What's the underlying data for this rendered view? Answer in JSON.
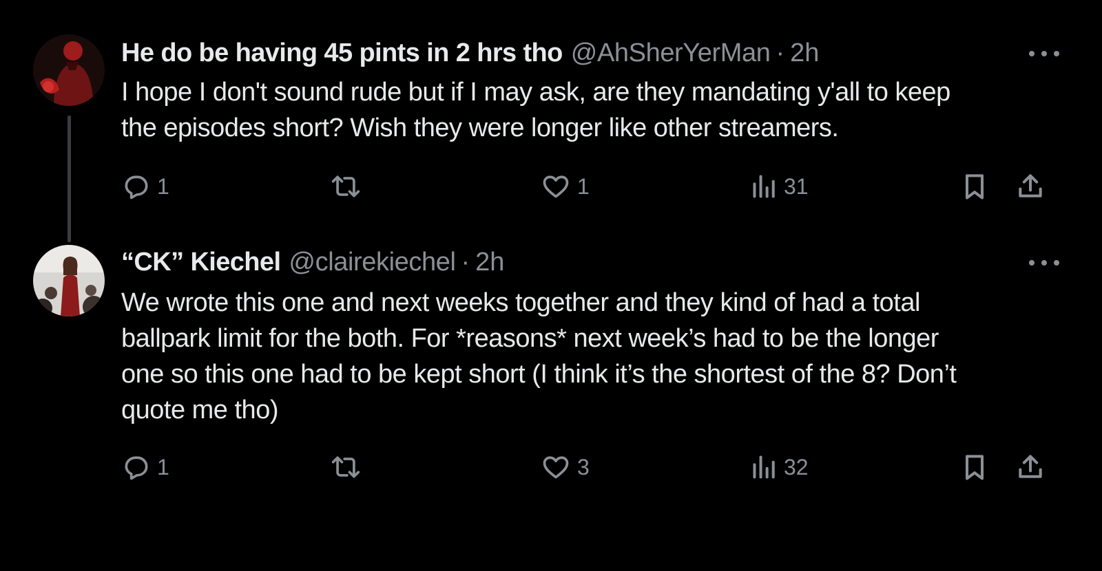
{
  "tweets": [
    {
      "display_name": "He do be having 45 pints in 2 hrs tho",
      "handle": "@AhSherYerMan",
      "separator": "·",
      "time": "2h",
      "text_lines": [
        "I hope I don't sound rude but if I may ask, are they mandating y'all to keep",
        "the episodes short? Wish they were longer like other streamers."
      ],
      "replies": "1",
      "reposts": "",
      "likes": "1",
      "views": "31",
      "avatar_icon": "avatar-red-figure"
    },
    {
      "display_name": "“CK” Kiechel",
      "handle": "@clairekiechel",
      "separator": "·",
      "time": "2h",
      "text_lines": [
        "We wrote this one and next weeks together and they kind of had a total",
        "ballpark limit for the both.  For *reasons* next week’s had to be the longer",
        "one so this one had to be kept short (I think it’s the shortest of the 8? Don’t",
        "quote me tho)"
      ],
      "replies": "1",
      "reposts": "",
      "likes": "3",
      "views": "32",
      "avatar_icon": "avatar-person-red-dress"
    }
  ],
  "icons": {
    "reply": "reply-icon",
    "repost": "repost-icon",
    "like": "heart-icon",
    "views": "views-icon",
    "bookmark": "bookmark-icon",
    "share": "share-icon",
    "more": "more-icon"
  },
  "colors": {
    "background": "#000000",
    "primary_text": "#e7e9ea",
    "secondary_text": "#8b9096",
    "thread_line": "#3a3d40"
  }
}
